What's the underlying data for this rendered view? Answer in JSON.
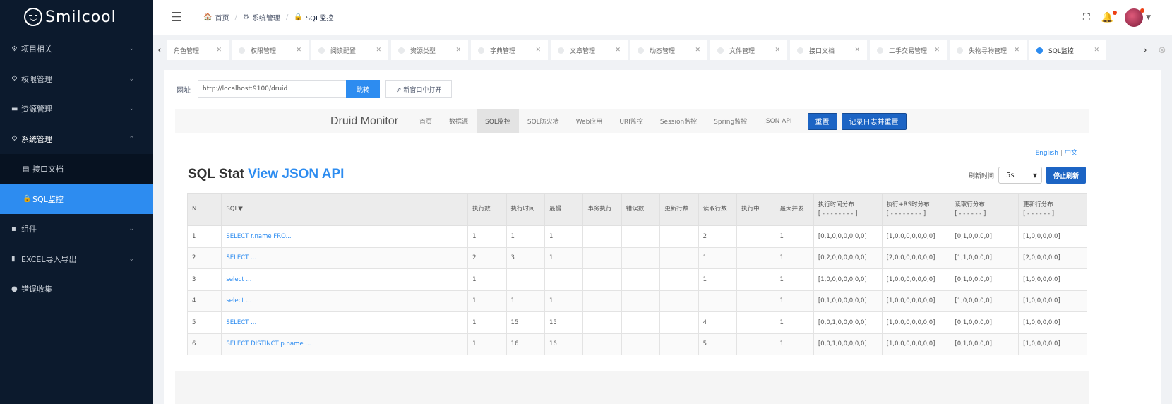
{
  "app": {
    "logo_text": "Smilcool"
  },
  "sidebar": {
    "items": [
      {
        "label": "项目相关",
        "icon": "gear-icon",
        "arrow": "⌄"
      },
      {
        "label": "权限管理",
        "icon": "gear-icon",
        "arrow": "⌄"
      },
      {
        "label": "资源管理",
        "icon": "folder-icon",
        "arrow": "⌄"
      },
      {
        "label": "系统管理",
        "icon": "gear-icon",
        "arrow": "⌃"
      },
      {
        "label": "接口文档",
        "icon": "document-icon"
      },
      {
        "label": "SQL监控",
        "icon": "lock-icon"
      },
      {
        "label": "组件",
        "icon": "component-icon",
        "arrow": "⌄"
      },
      {
        "label": "EXCEL导入导出",
        "icon": "chart-icon",
        "arrow": "⌄"
      },
      {
        "label": "错误收集",
        "icon": "bug-icon"
      }
    ]
  },
  "breadcrumb": [
    "首页",
    "系统管理",
    "SQL监控"
  ],
  "tabs": [
    {
      "label": "角色管理"
    },
    {
      "label": "权限管理"
    },
    {
      "label": "阅读配置"
    },
    {
      "label": "资源类型"
    },
    {
      "label": "字典管理"
    },
    {
      "label": "文章管理"
    },
    {
      "label": "动态管理"
    },
    {
      "label": "文件管理"
    },
    {
      "label": "接口文档"
    },
    {
      "label": "二手交易管理"
    },
    {
      "label": "失物寻物管理"
    },
    {
      "label": "SQL监控"
    }
  ],
  "urlbar": {
    "label": "网址",
    "value": "http://localhost:9100/druid",
    "go_label": "跳转",
    "new_window_label": "新窗口中打开"
  },
  "druid": {
    "brand": "Druid Monitor",
    "nav": [
      "首页",
      "数据源",
      "SQL监控",
      "SQL防火墙",
      "Web应用",
      "URI监控",
      "Session监控",
      "Spring监控",
      "JSON API"
    ],
    "reset_label": "重置",
    "log_reset_label": "记录日志并重置",
    "lang_en": "English",
    "lang_zh": "中文",
    "title": "SQL Stat",
    "title_link": "View JSON API",
    "refresh_label": "刷新时间",
    "refresh_value": "5s",
    "stop_refresh_label": "停止刷新"
  },
  "table": {
    "headers": [
      "N",
      "SQL▼",
      "执行数",
      "执行时间",
      "最慢",
      "事务执行",
      "错误数",
      "更新行数",
      "读取行数",
      "执行中",
      "最大并发",
      "执行时间分布\n[ - - - - - - - - ]",
      "执行+RS时分布\n[ - - - - - - - - ]",
      "读取行分布\n[ - - - - - - ]",
      "更新行分布\n[ - - - - - - ]"
    ],
    "rows": [
      [
        "1",
        "SELECT r.name FRO...",
        "1",
        "1",
        "1",
        "",
        "",
        "",
        "2",
        "",
        "1",
        "[0,1,0,0,0,0,0,0]",
        "[1,0,0,0,0,0,0,0]",
        "[0,1,0,0,0,0]",
        "[1,0,0,0,0,0]"
      ],
      [
        "2",
        "SELECT ...",
        "2",
        "3",
        "1",
        "",
        "",
        "",
        "1",
        "",
        "1",
        "[0,2,0,0,0,0,0,0]",
        "[2,0,0,0,0,0,0,0]",
        "[1,1,0,0,0,0]",
        "[2,0,0,0,0,0]"
      ],
      [
        "3",
        "select ...",
        "1",
        "",
        "",
        "",
        "",
        "",
        "1",
        "",
        "1",
        "[1,0,0,0,0,0,0,0]",
        "[1,0,0,0,0,0,0,0]",
        "[0,1,0,0,0,0]",
        "[1,0,0,0,0,0]"
      ],
      [
        "4",
        "select ...",
        "1",
        "1",
        "1",
        "",
        "",
        "",
        "",
        "",
        "1",
        "[0,1,0,0,0,0,0,0]",
        "[1,0,0,0,0,0,0,0]",
        "[1,0,0,0,0,0]",
        "[1,0,0,0,0,0]"
      ],
      [
        "5",
        "SELECT ...",
        "1",
        "15",
        "15",
        "",
        "",
        "",
        "4",
        "",
        "1",
        "[0,0,1,0,0,0,0,0]",
        "[1,0,0,0,0,0,0,0]",
        "[0,1,0,0,0,0]",
        "[1,0,0,0,0,0]"
      ],
      [
        "6",
        "SELECT DISTINCT p.name ...",
        "1",
        "16",
        "16",
        "",
        "",
        "",
        "5",
        "",
        "1",
        "[0,0,1,0,0,0,0,0]",
        "[1,0,0,0,0,0,0,0]",
        "[0,1,0,0,0,0]",
        "[1,0,0,0,0,0]"
      ]
    ]
  }
}
